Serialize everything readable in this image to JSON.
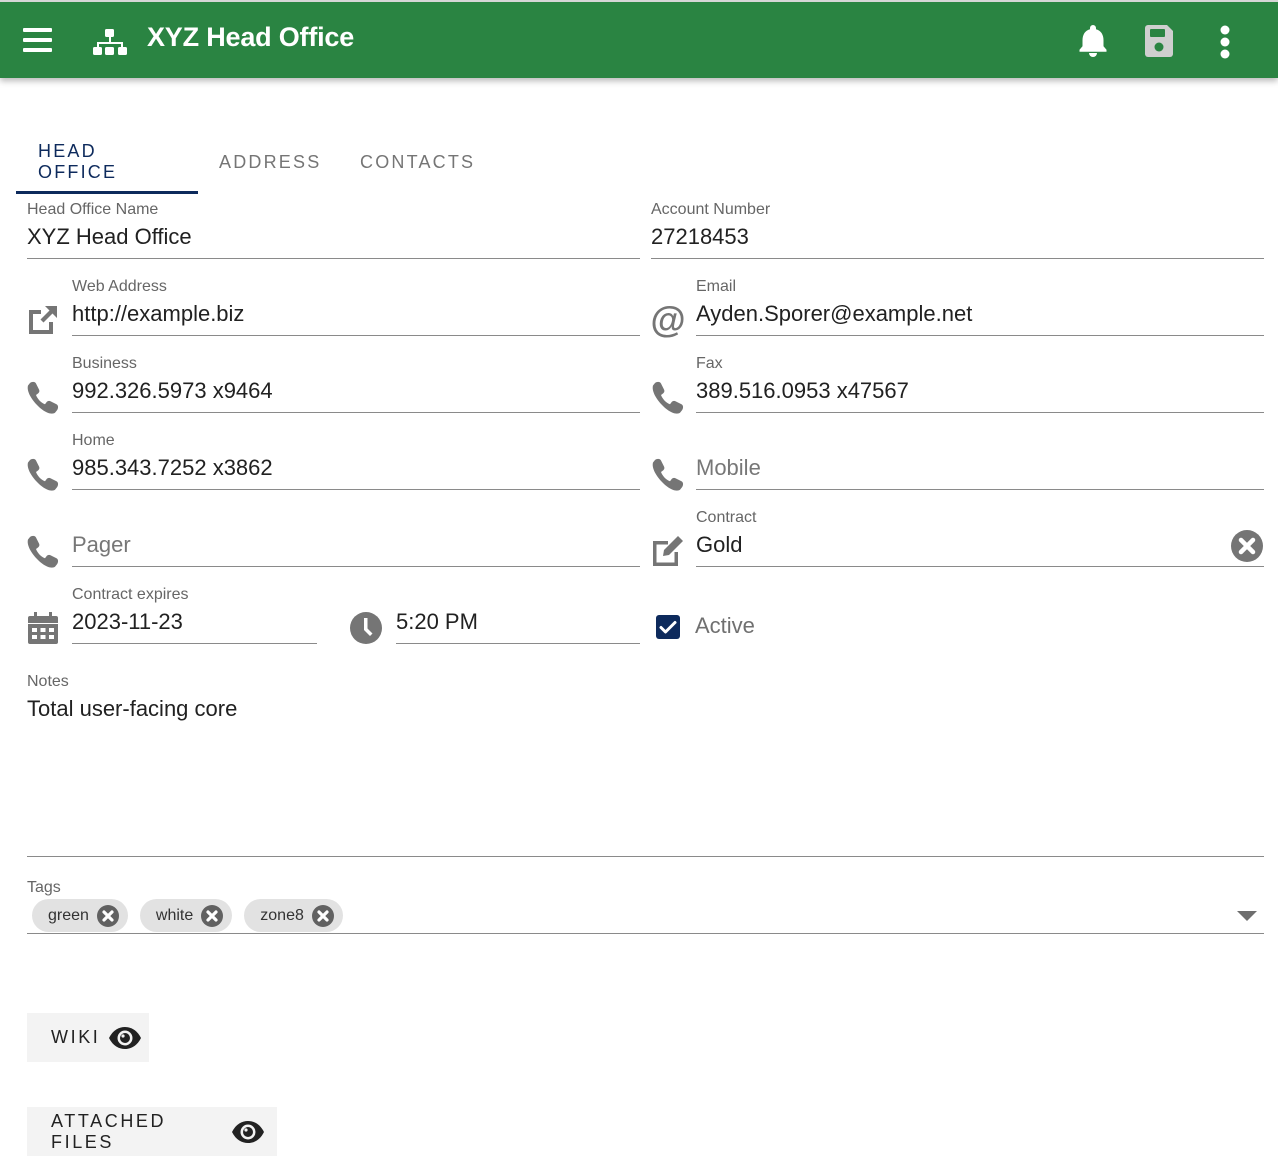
{
  "appbar": {
    "title": "XYZ Head Office",
    "icons": {
      "menu": "menu-icon",
      "logo": "sitemap-icon",
      "notifications": "bell-icon",
      "save": "save-icon",
      "more": "more-vertical-icon"
    },
    "background_color": "#2a8442",
    "save_disabled": true
  },
  "tabs": [
    {
      "label": "HEAD OFFICE",
      "active": true
    },
    {
      "label": "ADDRESS",
      "active": false
    },
    {
      "label": "CONTACTS",
      "active": false
    }
  ],
  "accent_color": "#0d2a5c",
  "form": {
    "head_office_name": {
      "label": "Head Office Name",
      "value": "XYZ Head Office"
    },
    "account_number": {
      "label": "Account Number",
      "value": "27218453"
    },
    "web_address": {
      "label": "Web Address",
      "value": "http://example.biz",
      "icon": "open-external-icon"
    },
    "email": {
      "label": "Email",
      "value": "Ayden.Sporer@example.net",
      "icon": "at-sign-icon"
    },
    "business": {
      "label": "Business",
      "value": "992.326.5973 x9464",
      "icon": "phone-icon"
    },
    "fax": {
      "label": "Fax",
      "value": "389.516.0953 x47567",
      "icon": "phone-icon"
    },
    "home": {
      "label": "Home",
      "value": "985.343.7252 x3862",
      "icon": "phone-icon"
    },
    "mobile": {
      "placeholder": "Mobile",
      "value": "",
      "icon": "phone-icon"
    },
    "pager": {
      "placeholder": "Pager",
      "value": "",
      "icon": "phone-icon"
    },
    "contract": {
      "label": "Contract",
      "value": "Gold",
      "icon": "edit-icon"
    },
    "contract_expires": {
      "label": "Contract expires",
      "date": "2023-11-23",
      "time": "5:20 PM"
    },
    "active": {
      "label": "Active",
      "checked": true
    },
    "notes": {
      "label": "Notes",
      "value": "Total user-facing core"
    },
    "tags": {
      "label": "Tags",
      "items": [
        "green",
        "white",
        "zone8"
      ]
    }
  },
  "buttons": {
    "wiki": "WIKI",
    "attached_files": "ATTACHED FILES"
  }
}
